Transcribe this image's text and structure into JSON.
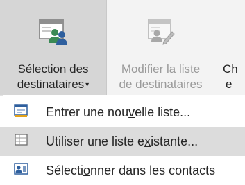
{
  "ribbon": {
    "select_recipients": {
      "line1": "Sélection des",
      "line2": "destinataires",
      "caret": "▾",
      "icon": "recipients-people-icon"
    },
    "edit_list": {
      "line1": "Modifier la liste",
      "line2": "de destinataires",
      "icon": "edit-recipient-list-icon",
      "enabled": false
    },
    "partial": {
      "line1": "Ch",
      "line2": "e"
    }
  },
  "menu": {
    "items": [
      {
        "pre": "Entrer une nou",
        "key": "v",
        "post": "elle liste...",
        "icon": "new-list-icon"
      },
      {
        "pre": "Utiliser une liste e",
        "key": "x",
        "post": "istante...",
        "icon": "existing-list-icon",
        "highlighted": true
      },
      {
        "pre": "Sélecti",
        "key": "o",
        "post": "nner dans les contacts",
        "icon": "contacts-card-icon"
      }
    ]
  },
  "colors": {
    "ribbon_bg": "#f3f3f3",
    "pressed_bg": "#d6d6d6",
    "hover_bg": "#dcdcdc",
    "accent_green": "#3a8a55",
    "accent_blue": "#2e5f9e",
    "disabled_text": "#9a9a9a"
  }
}
